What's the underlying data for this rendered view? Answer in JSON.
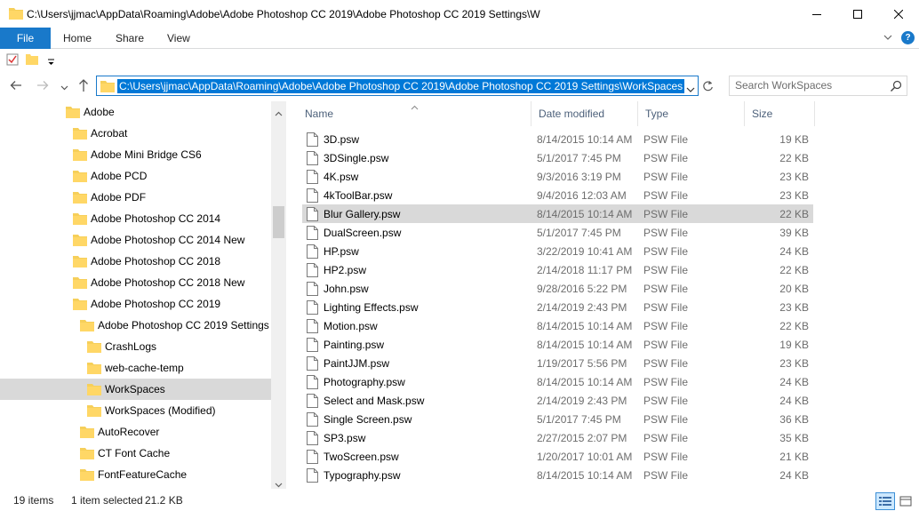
{
  "window": {
    "title": "C:\\Users\\jjmac\\AppData\\Roaming\\Adobe\\Adobe Photoshop CC 2019\\Adobe Photoshop CC 2019 Settings\\W",
    "icons": {
      "folder": "folder-icon",
      "minimize": "minimize-icon",
      "maximize": "maximize-icon",
      "close": "close-icon"
    }
  },
  "ribbon": {
    "tabs": {
      "file": "File",
      "home": "Home",
      "share": "Share",
      "view": "View"
    },
    "accent": "#1979ca"
  },
  "address": {
    "path": "C:\\Users\\jjmac\\AppData\\Roaming\\Adobe\\Adobe Photoshop CC 2019\\Adobe Photoshop CC 2019 Settings\\WorkSpaces",
    "selection_color": "#0078d7"
  },
  "search": {
    "placeholder": "Search WorkSpaces"
  },
  "tree": {
    "items": [
      {
        "label": "Adobe",
        "level": 0
      },
      {
        "label": "Acrobat",
        "level": 1
      },
      {
        "label": "Adobe Mini Bridge CS6",
        "level": 1
      },
      {
        "label": "Adobe PCD",
        "level": 1
      },
      {
        "label": "Adobe PDF",
        "level": 1
      },
      {
        "label": "Adobe Photoshop CC 2014",
        "level": 1
      },
      {
        "label": "Adobe Photoshop CC 2014 New",
        "level": 1
      },
      {
        "label": "Adobe Photoshop CC 2018",
        "level": 1
      },
      {
        "label": "Adobe Photoshop CC 2018 New",
        "level": 1
      },
      {
        "label": "Adobe Photoshop CC 2019",
        "level": 1
      },
      {
        "label": "Adobe Photoshop CC 2019 Settings",
        "level": 2
      },
      {
        "label": "CrashLogs",
        "level": 3
      },
      {
        "label": "web-cache-temp",
        "level": 3
      },
      {
        "label": "WorkSpaces",
        "level": 3,
        "selected": true
      },
      {
        "label": "WorkSpaces (Modified)",
        "level": 3
      },
      {
        "label": "AutoRecover",
        "level": 2
      },
      {
        "label": "CT Font Cache",
        "level": 2
      },
      {
        "label": "FontFeatureCache",
        "level": 2
      }
    ]
  },
  "list": {
    "columns": {
      "name": "Name",
      "date": "Date modified",
      "type": "Type",
      "size": "Size"
    },
    "files": [
      {
        "name": "3D.psw",
        "date": "8/14/2015 10:14 AM",
        "type": "PSW File",
        "size": "19 KB"
      },
      {
        "name": "3DSingle.psw",
        "date": "5/1/2017 7:45 PM",
        "type": "PSW File",
        "size": "22 KB"
      },
      {
        "name": "4K.psw",
        "date": "9/3/2016 3:19 PM",
        "type": "PSW File",
        "size": "23 KB"
      },
      {
        "name": "4kToolBar.psw",
        "date": "9/4/2016 12:03 AM",
        "type": "PSW File",
        "size": "23 KB"
      },
      {
        "name": "Blur Gallery.psw",
        "date": "8/14/2015 10:14 AM",
        "type": "PSW File",
        "size": "22 KB",
        "selected": true
      },
      {
        "name": "DualScreen.psw",
        "date": "5/1/2017 7:45 PM",
        "type": "PSW File",
        "size": "39 KB"
      },
      {
        "name": "HP.psw",
        "date": "3/22/2019 10:41 AM",
        "type": "PSW File",
        "size": "24 KB"
      },
      {
        "name": "HP2.psw",
        "date": "2/14/2018 11:17 PM",
        "type": "PSW File",
        "size": "22 KB"
      },
      {
        "name": "John.psw",
        "date": "9/28/2016 5:22 PM",
        "type": "PSW File",
        "size": "20 KB"
      },
      {
        "name": "Lighting Effects.psw",
        "date": "2/14/2019 2:43 PM",
        "type": "PSW File",
        "size": "23 KB"
      },
      {
        "name": "Motion.psw",
        "date": "8/14/2015 10:14 AM",
        "type": "PSW File",
        "size": "22 KB"
      },
      {
        "name": "Painting.psw",
        "date": "8/14/2015 10:14 AM",
        "type": "PSW File",
        "size": "19 KB"
      },
      {
        "name": "PaintJJM.psw",
        "date": "1/19/2017 5:56 PM",
        "type": "PSW File",
        "size": "23 KB"
      },
      {
        "name": "Photography.psw",
        "date": "8/14/2015 10:14 AM",
        "type": "PSW File",
        "size": "24 KB"
      },
      {
        "name": "Select and Mask.psw",
        "date": "2/14/2019 2:43 PM",
        "type": "PSW File",
        "size": "24 KB"
      },
      {
        "name": "Single Screen.psw",
        "date": "5/1/2017 7:45 PM",
        "type": "PSW File",
        "size": "36 KB"
      },
      {
        "name": "SP3.psw",
        "date": "2/27/2015 2:07 PM",
        "type": "PSW File",
        "size": "35 KB"
      },
      {
        "name": "TwoScreen.psw",
        "date": "1/20/2017 10:01 AM",
        "type": "PSW File",
        "size": "21 KB"
      },
      {
        "name": "Typography.psw",
        "date": "8/14/2015 10:14 AM",
        "type": "PSW File",
        "size": "24 KB"
      }
    ]
  },
  "status": {
    "item_count": "19 items",
    "selection": "1 item selected",
    "selection_size": "21.2 KB"
  }
}
